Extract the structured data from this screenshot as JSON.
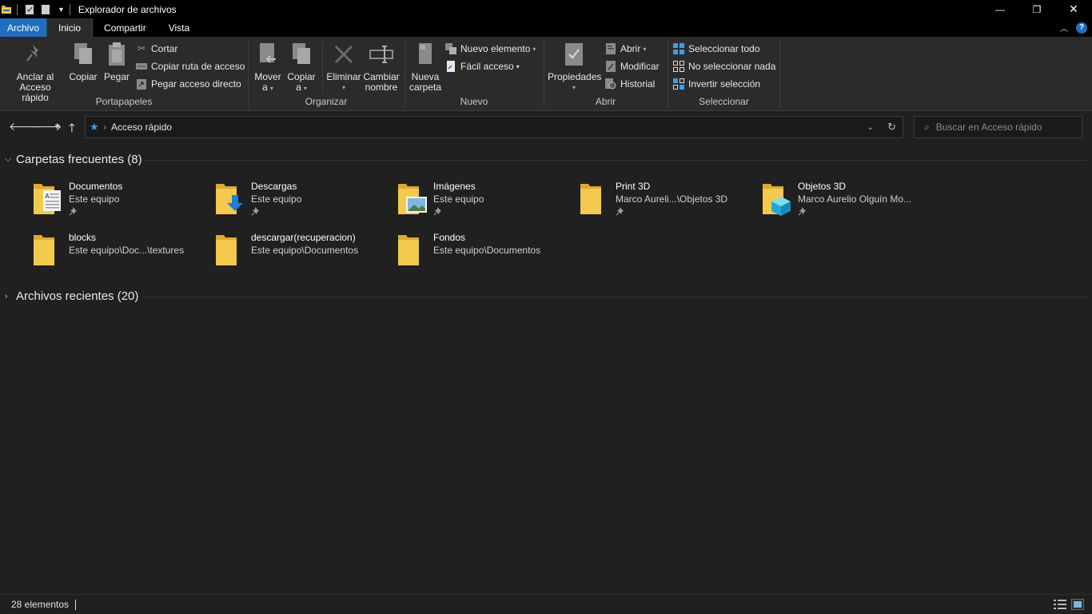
{
  "window": {
    "title": "Explorador de archivos",
    "controls": {
      "minimize": "—",
      "restore": "❐",
      "close": "✕"
    }
  },
  "tabs": [
    {
      "label": "Archivo"
    },
    {
      "label": "Inicio"
    },
    {
      "label": "Compartir"
    },
    {
      "label": "Vista"
    }
  ],
  "ribbon": {
    "portapapeles": {
      "label": "Portapapeles",
      "pin": "Anclar al\nAcceso rápido",
      "pin_l1": "Anclar al",
      "pin_l2": "Acceso rápido",
      "copy": "Copiar",
      "paste": "Pegar",
      "cut": "Cortar",
      "copy_path": "Copiar ruta de acceso",
      "paste_shortcut": "Pegar acceso directo"
    },
    "organizar": {
      "label": "Organizar",
      "move_l1": "Mover",
      "move_l2": "a",
      "copy_l1": "Copiar",
      "copy_l2": "a",
      "delete": "Eliminar",
      "rename_l1": "Cambiar",
      "rename_l2": "nombre"
    },
    "nuevo": {
      "label": "Nuevo",
      "new_folder_l1": "Nueva",
      "new_folder_l2": "carpeta",
      "new_item": "Nuevo elemento",
      "easy_access": "Fácil acceso"
    },
    "abrir": {
      "label": "Abrir",
      "properties": "Propiedades",
      "open": "Abrir",
      "edit": "Modificar",
      "history": "Historial"
    },
    "seleccionar": {
      "label": "Seleccionar",
      "select_all": "Seleccionar todo",
      "select_none": "No seleccionar nada",
      "invert": "Invertir selección"
    }
  },
  "address": {
    "crumb": "Acceso rápido",
    "search_placeholder": "Buscar en Acceso rápido"
  },
  "frequent": {
    "title": "Carpetas frecuentes (8)",
    "items": [
      {
        "name": "Documentos",
        "location": "Este equipo",
        "icon": "documents-folder-icon",
        "pinned": true
      },
      {
        "name": "Descargas",
        "location": "Este equipo",
        "icon": "downloads-folder-icon",
        "pinned": true
      },
      {
        "name": "Imágenes",
        "location": "Este equipo",
        "icon": "pictures-folder-icon",
        "pinned": true
      },
      {
        "name": "Print 3D",
        "location": "Marco Aureli...\\Objetos 3D",
        "icon": "folder-icon",
        "pinned": true
      },
      {
        "name": "Objetos 3D",
        "location": "Marco Aurelio Olguín Mo...",
        "icon": "3d-objects-folder-icon",
        "pinned": true
      },
      {
        "name": "blocks",
        "location": "Este equipo\\Doc...\\textures",
        "icon": "folder-icon",
        "pinned": false
      },
      {
        "name": "descargar(recuperacion)",
        "location": "Este equipo\\Documentos",
        "icon": "folder-icon",
        "pinned": false
      },
      {
        "name": "Fondos",
        "location": "Este equipo\\Documentos",
        "icon": "folder-icon",
        "pinned": false
      }
    ]
  },
  "recent": {
    "title": "Archivos recientes (20)"
  },
  "status": {
    "count": "28 elementos"
  },
  "colors": {
    "accent": "#1f6fbd",
    "folder": "#f3c94e",
    "background": "#202020"
  }
}
